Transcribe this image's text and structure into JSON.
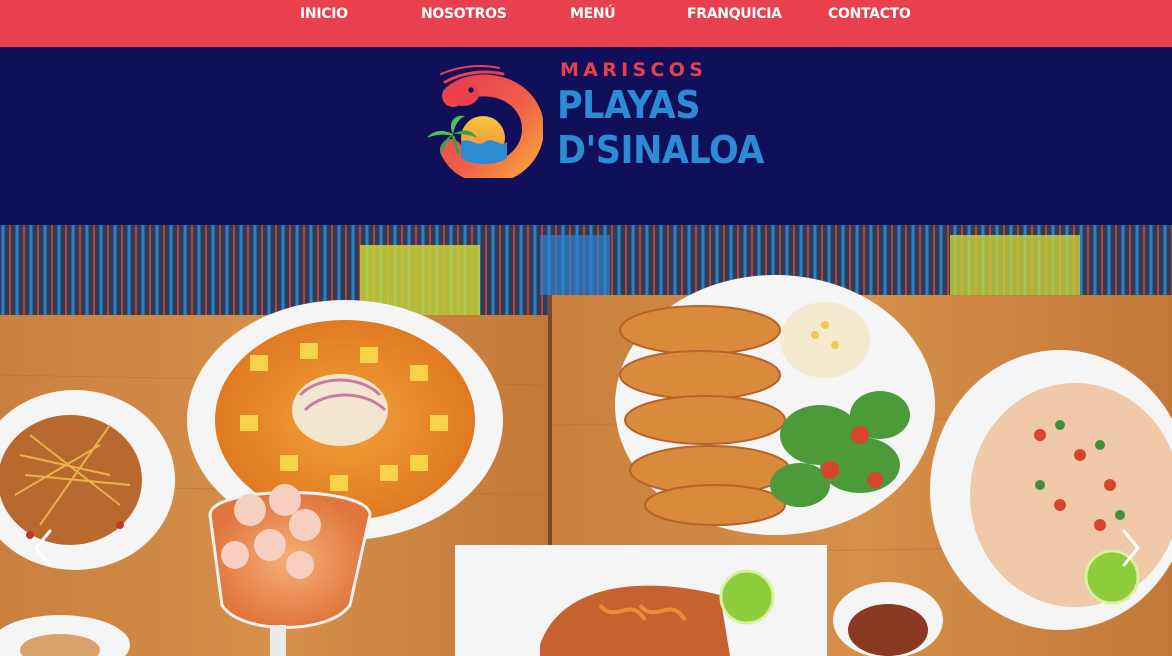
{
  "nav": {
    "items": [
      {
        "label": "INICIO"
      },
      {
        "label": "NOSOTROS"
      },
      {
        "label": "MENÚ"
      },
      {
        "label": "FRANQUICIA"
      },
      {
        "label": "CONTACTO"
      }
    ]
  },
  "brand": {
    "line_small": "MARISCOS",
    "line_big_1": "PLAYAS",
    "line_big_2": "D'SINALOA",
    "logo_icon": "shrimp-logo-icon"
  },
  "hero": {
    "prev_icon": "chevron-left-icon",
    "next_icon": "chevron-right-icon"
  },
  "colors": {
    "nav_bg": "#e8414d",
    "brand_bg": "#0f0f5a",
    "brand_small_text": "#e8414d",
    "brand_big_text": "#2d8bd4"
  }
}
